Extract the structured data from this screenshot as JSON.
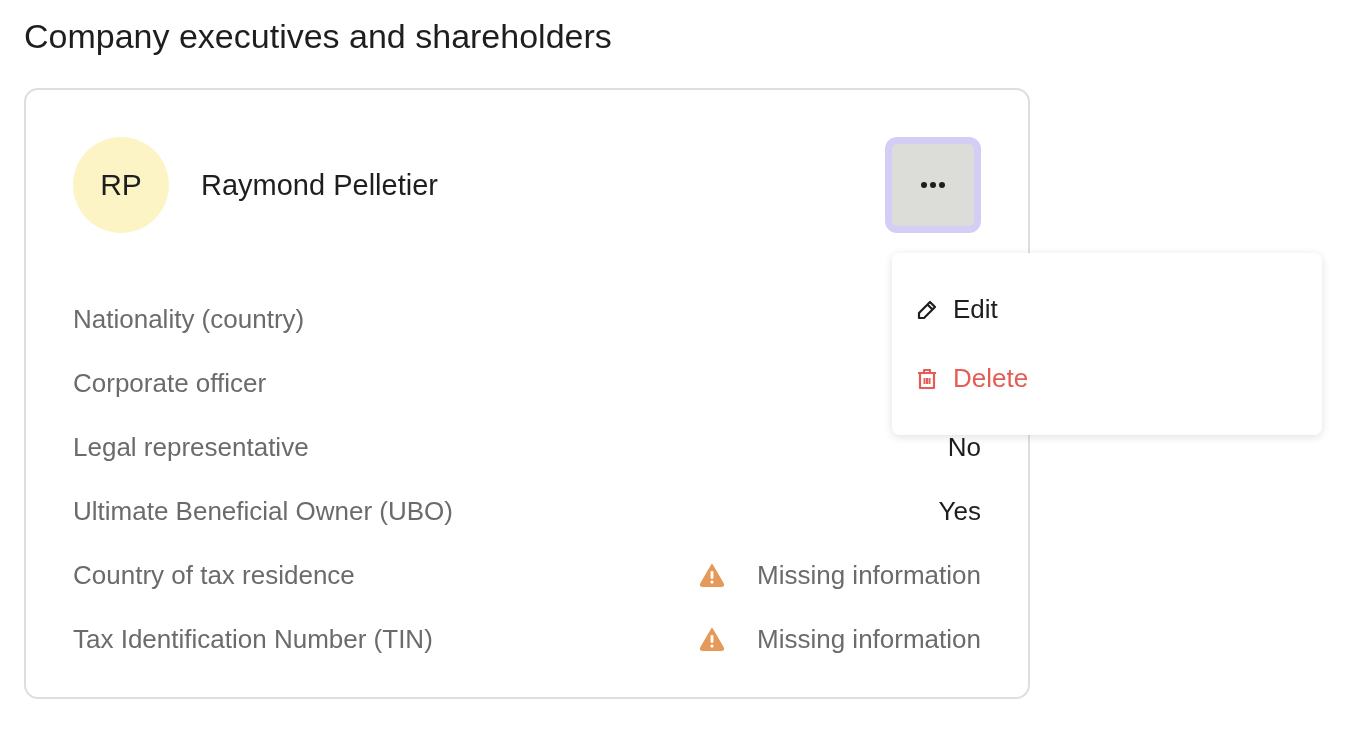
{
  "heading": "Company executives and shareholders",
  "person": {
    "initials": "RP",
    "name": "Raymond Pelletier"
  },
  "more_button": {
    "focused": true
  },
  "fields": [
    {
      "label": "Nationality (country)",
      "kind": "plain"
    },
    {
      "label": "Corporate officer",
      "kind": "plain"
    },
    {
      "label": "Legal representative",
      "value": "No",
      "kind": "plain"
    },
    {
      "label": "Ultimate Beneficial Owner (UBO)",
      "value": "Yes",
      "kind": "plain"
    },
    {
      "label": "Country of tax residence",
      "value": "Missing information",
      "kind": "warning"
    },
    {
      "label": "Tax Identification Number (TIN)",
      "value": "Missing information",
      "kind": "warning"
    }
  ],
  "menu": {
    "open": true,
    "items": [
      {
        "label": "Edit",
        "kind": "edit"
      },
      {
        "label": "Delete",
        "kind": "delete"
      }
    ]
  }
}
